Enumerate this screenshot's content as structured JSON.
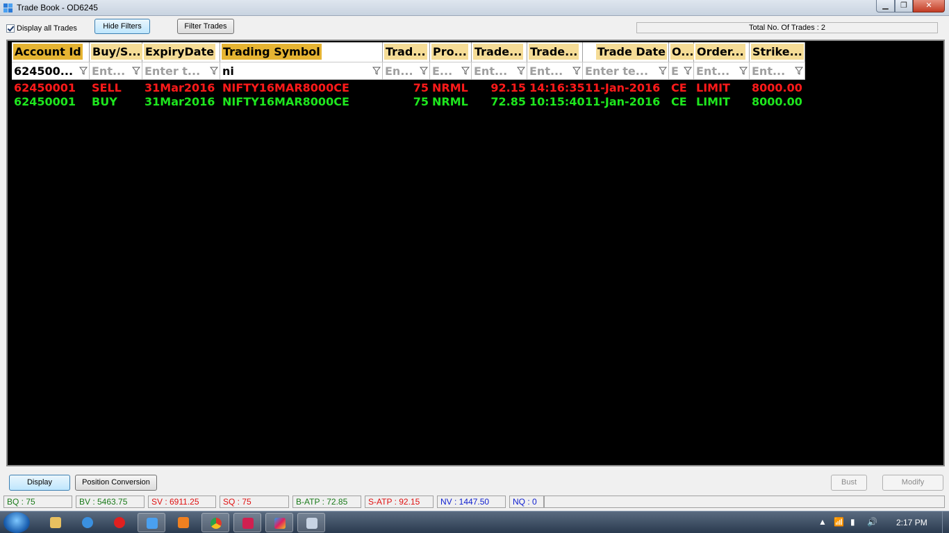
{
  "window": {
    "title": "Trade Book - OD6245"
  },
  "toolbar": {
    "display_all_label": "Display all Trades",
    "display_all_checked": true,
    "hide_filters_label": "Hide Filters",
    "filter_trades_label": "Filter Trades",
    "total_trades_text": "Total No. Of Trades : 2"
  },
  "grid": {
    "columns": [
      {
        "label": "Account Id",
        "filter": "624500...",
        "filter_is_value": true
      },
      {
        "label": "Buy/S...",
        "filter": "Ent...",
        "filter_is_value": false
      },
      {
        "label": "ExpiryDate",
        "filter": "Enter t...",
        "filter_is_value": false
      },
      {
        "label": "Trading Symbol",
        "filter": "ni",
        "filter_is_value": true
      },
      {
        "label": "Trad...",
        "filter": "En...",
        "filter_is_value": false
      },
      {
        "label": "Pro...",
        "filter": "E...",
        "filter_is_value": false
      },
      {
        "label": "Trade...",
        "filter": "Ent...",
        "filter_is_value": false
      },
      {
        "label": "Trade...",
        "filter": "Ent...",
        "filter_is_value": false
      },
      {
        "label": "Trade Date",
        "filter": "Enter te...",
        "filter_is_value": false
      },
      {
        "label": "O...",
        "filter": "E",
        "filter_is_value": false
      },
      {
        "label": "Order...",
        "filter": "Ent...",
        "filter_is_value": false
      },
      {
        "label": "Strike...",
        "filter": "Ent...",
        "filter_is_value": false
      }
    ],
    "rows": [
      {
        "side": "sell",
        "cells": [
          "62450001",
          "SELL",
          "31Mar2016",
          "NIFTY16MAR8000CE",
          "75",
          "NRML",
          "92.15",
          "14:16:35",
          "11-Jan-2016",
          "CE",
          "LIMIT",
          "8000.00"
        ]
      },
      {
        "side": "buy",
        "cells": [
          "62450001",
          "BUY",
          "31Mar2016",
          "NIFTY16MAR8000CE",
          "75",
          "NRML",
          "72.85",
          "10:15:40",
          "11-Jan-2016",
          "CE",
          "LIMIT",
          "8000.00"
        ]
      }
    ]
  },
  "bottom": {
    "display_label": "Display",
    "position_conversion_label": "Position Conversion",
    "bust_label": "Bust",
    "modify_label": "Modify"
  },
  "status": {
    "bq": "BQ : 75",
    "bv": "BV : 5463.75",
    "sv": "SV : 6911.25",
    "sq": "SQ : 75",
    "batp": "B-ATP : 72.85",
    "satp": "S-ATP : 92.15",
    "nv": "NV : 1447.50",
    "nq": "NQ : 0"
  },
  "colors": {
    "sell": "#ff1a1a",
    "buy": "#1ee61e",
    "header_dark": "#e6b432",
    "header_light": "#f5dc96",
    "status_green": "#1a7a1a",
    "status_red": "#e01010",
    "status_blue": "#1020d0"
  },
  "taskbar": {
    "items": [
      "windows-explorer",
      "internet-explorer",
      "opera",
      "trade-app",
      "media-player",
      "chrome",
      "app-red",
      "app-triangle",
      "calculator"
    ],
    "clock": "2:17 PM"
  }
}
